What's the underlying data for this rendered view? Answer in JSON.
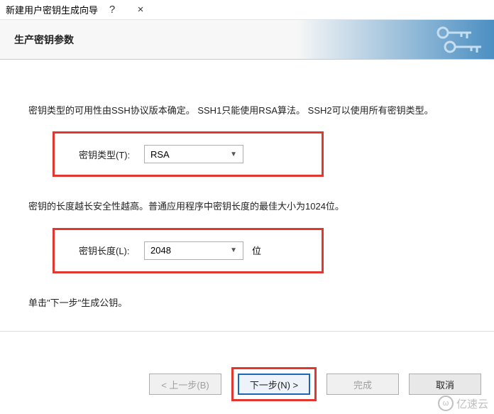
{
  "window": {
    "title": "新建用户密钥生成向导",
    "help": "?",
    "close": "×"
  },
  "header": {
    "title": "生产密钥参数"
  },
  "content": {
    "desc_type": "密钥类型的可用性由SSH协议版本确定。 SSH1只能使用RSA算法。 SSH2可以使用所有密钥类型。",
    "label_type": "密钥类型(T):",
    "value_type": "RSA",
    "desc_length": "密钥的长度越长安全性越高。普通应用程序中密钥长度的最佳大小为1024位。",
    "label_length": "密钥长度(L):",
    "value_length": "2048",
    "unit_length": "位",
    "desc_next": "单击\"下一步\"生成公钥。"
  },
  "footer": {
    "back": "< 上一步(B)",
    "next": "下一步(N) >",
    "finish": "完成",
    "cancel": "取消"
  },
  "watermark": "亿速云"
}
